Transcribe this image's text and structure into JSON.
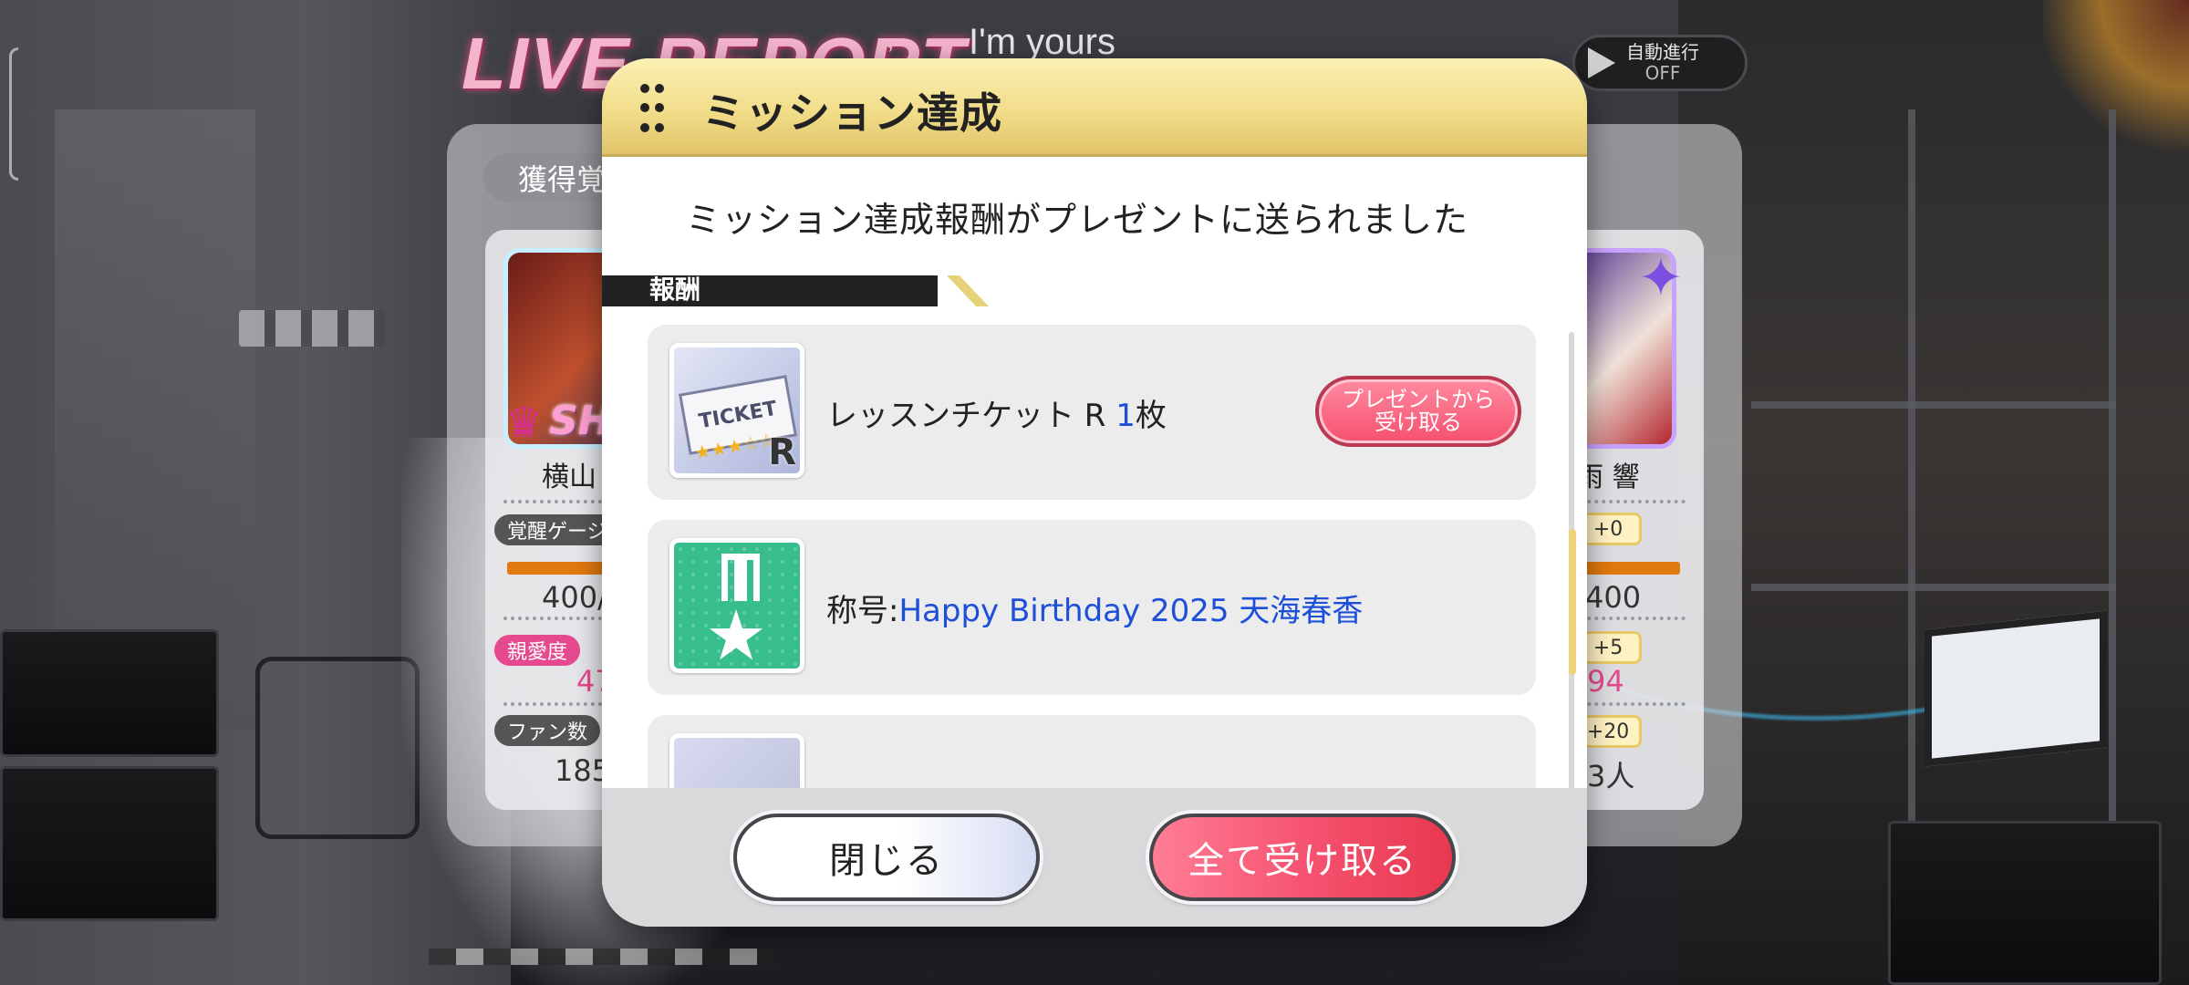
{
  "header": {
    "live_title": "LIVE REPORT",
    "song_name": "I'm yours",
    "auto_play": {
      "label": "自動進行",
      "state": "OFF"
    }
  },
  "background_report": {
    "tab_label": "獲得覚",
    "left_card": {
      "badge": "SH",
      "name": "横山",
      "gauge_label": "覚醒ゲージ",
      "gauge_value": "400/",
      "affection_label": "親愛度",
      "affection_value": "47",
      "fans_label": "ファン数",
      "fans_value": "185"
    },
    "right_card": {
      "name": "雨 響",
      "gauge_delta": "+0",
      "gauge_value": "400",
      "affection_delta": "+5",
      "affection_value": "94",
      "fans_delta": "+20",
      "fans_value": "3人"
    }
  },
  "dialog": {
    "title": "ミッション達成",
    "message": "ミッション達成報酬がプレゼントに送られました",
    "section_label": "報酬",
    "rewards": [
      {
        "icon": "lesson-ticket-r-icon",
        "name_prefix": "レッスンチケット R ",
        "quantity": "1",
        "unit": "枚",
        "button": {
          "line1": "プレゼントから",
          "line2": "受け取る"
        },
        "ticket_text": "TICKET",
        "ticket_grade": "R"
      },
      {
        "icon": "title-medal-icon",
        "name_prefix": "称号:",
        "title_name": "Happy Birthday 2025 天海春香"
      },
      {
        "icon": "reward-item-icon"
      }
    ],
    "close_button": "閉じる",
    "receive_all_button": "全て受け取る"
  },
  "colors": {
    "accent_pink": "#f5506e",
    "header_gold": "#f1dd8a",
    "link_blue": "#1d4fd8"
  }
}
